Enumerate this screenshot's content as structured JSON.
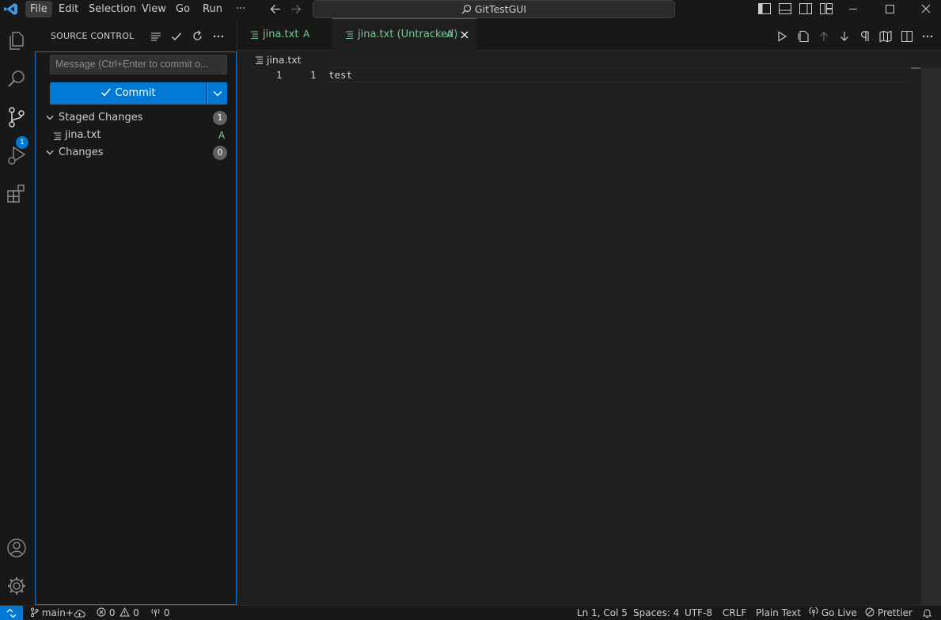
{
  "menu": [
    "File",
    "Edit",
    "Selection",
    "View",
    "Go",
    "Run",
    "···"
  ],
  "title": {
    "search_label": "GitTestGUI"
  },
  "activity": {
    "scm_badge": "1"
  },
  "sidebar": {
    "title": "SOURCE CONTROL",
    "commit_placeholder": "Message (Ctrl+Enter to commit o...",
    "commit_label": "Commit",
    "staged": {
      "label": "Staged Changes",
      "count": "1",
      "files": [
        {
          "name": "jina.txt",
          "status": "A"
        }
      ]
    },
    "changes": {
      "label": "Changes",
      "count": "0"
    }
  },
  "tabs": [
    {
      "label": "jina.txt",
      "status": "A"
    },
    {
      "label": "jina.txt (Untracked)",
      "status": "A"
    }
  ],
  "editor": {
    "breadcrumb": "jina.txt",
    "lines": [
      {
        "old_no": "1",
        "new_no": "1",
        "text": "test"
      }
    ]
  },
  "status": {
    "branch": "main+",
    "errors": "0",
    "warnings": "0",
    "ports": "0",
    "position": "Ln 1, Col 5",
    "spaces": "Spaces: 4",
    "encoding": "UTF-8",
    "eol": "CRLF",
    "language": "Plain Text",
    "golive": "Go Live",
    "prettier": "Prettier"
  },
  "colors": {
    "accent": "#0078d4",
    "added": "#73c991",
    "background": "#1f1f1f",
    "panel": "#181818"
  }
}
